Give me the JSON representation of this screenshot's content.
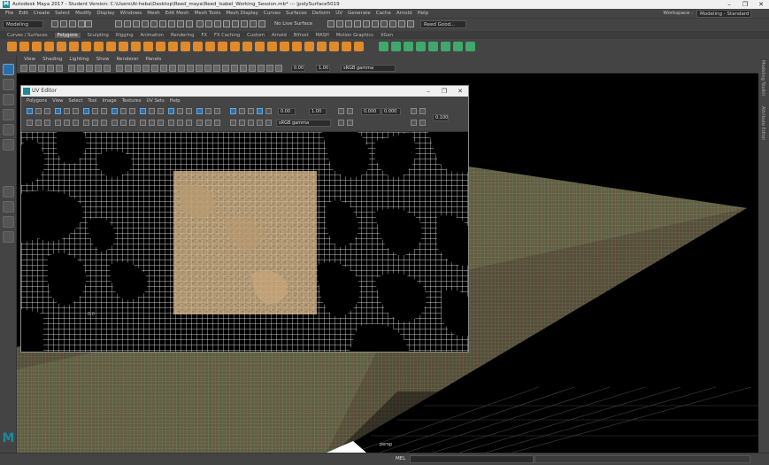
{
  "window": {
    "title": "Autodesk Maya 2017 - Student Version: C:\\Users\\Al-heba\\Desktop\\Reed_maya\\Reed_Isabel_Working_Session.mb* --- |polySurface5019",
    "app_icon": "M",
    "minimize": "–",
    "maximize": "❐",
    "close": "✕"
  },
  "menubar": {
    "items": [
      "File",
      "Edit",
      "Create",
      "Select",
      "Modify",
      "Display",
      "Windows",
      "Mesh",
      "Edit Mesh",
      "Mesh Tools",
      "Mesh Display",
      "Curves",
      "Surfaces",
      "Deform",
      "UV",
      "Generate",
      "Cache",
      "Arnold",
      "Help"
    ],
    "workspace_label": "Workspace :",
    "workspace_value": "Modeling - Standard"
  },
  "statusline": {
    "mode": "Modeling",
    "live_surface": "No Live Surface",
    "user": "Reed Good..."
  },
  "shelf_tabs": {
    "items": [
      "Curves / Surfaces",
      "Polygons",
      "Sculpting",
      "Rigging",
      "Animation",
      "Rendering",
      "FX",
      "FX Caching",
      "Custom",
      "Arnold",
      "Bifrost",
      "MASH",
      "Motion Graphics",
      "XGen"
    ],
    "active": "Polygons"
  },
  "viewport": {
    "menu": [
      "View",
      "Shading",
      "Lighting",
      "Show",
      "Renderer",
      "Panels"
    ],
    "exposure": "0.00",
    "gamma": "1.00",
    "colorspace": "sRGB gamma",
    "camera_label": "persp"
  },
  "uv_editor": {
    "title": "UV Editor",
    "menu": [
      "Polygons",
      "View",
      "Select",
      "Tool",
      "Image",
      "Textures",
      "UV Sets",
      "Help"
    ],
    "field_a": "0.00",
    "field_b": "1.00",
    "field_c": "0.000",
    "field_d": "0.000",
    "step_value": "0.100",
    "colorspace": "sRGB gamma",
    "tick_label": "0.0"
  },
  "right_panel": {
    "tabs": [
      "Modeling Toolkit",
      "Attribute Editor"
    ]
  },
  "cmdline": {
    "lang": "MEL"
  },
  "colors": {
    "maya_teal": "#1a8a9c",
    "shelf_orange": "#e08a2c",
    "shelf_green": "#3fa86a",
    "ground_green": "#5fcf8a",
    "sand": "#d6b88e"
  }
}
